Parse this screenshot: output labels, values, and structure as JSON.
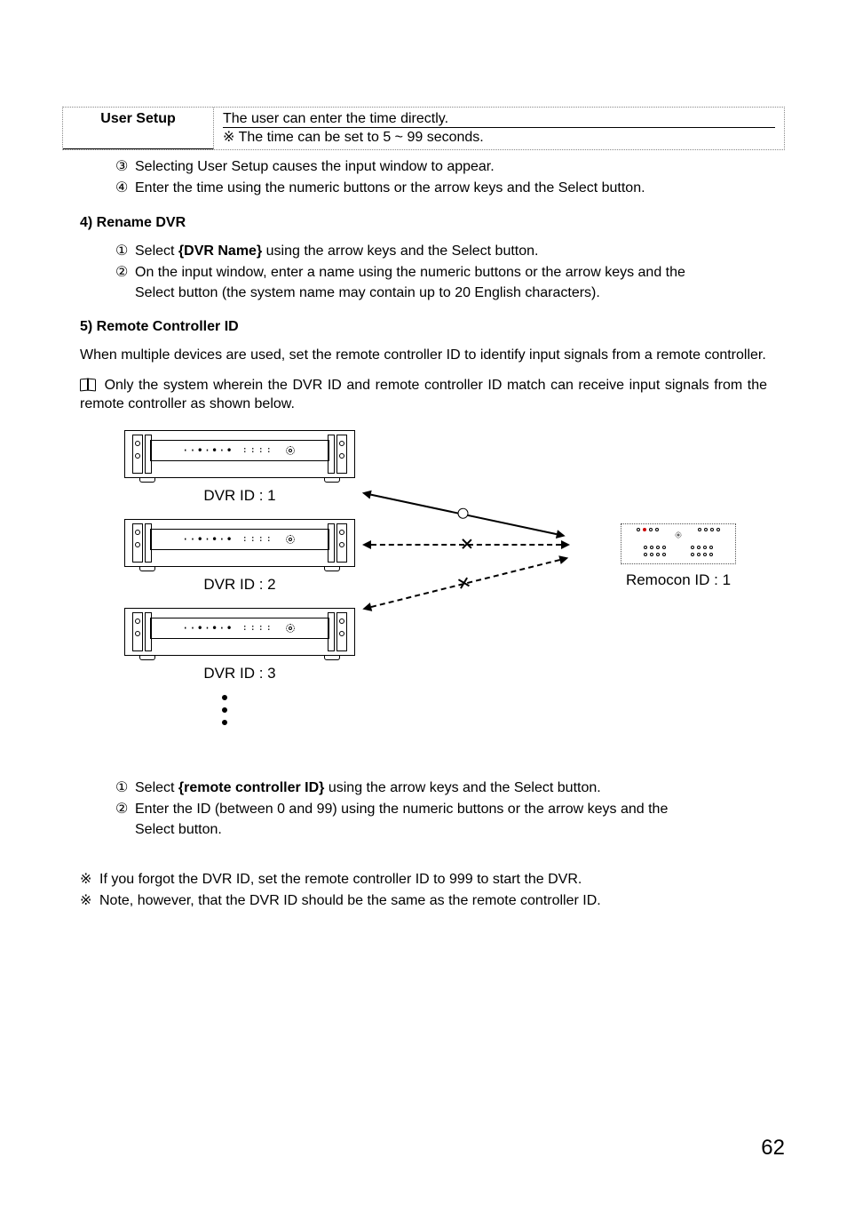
{
  "table": {
    "header": "User Setup",
    "line1": "The user can enter the time directly.",
    "line2_sym": "※",
    "line2": "The time can be set to 5 ~ 99 seconds."
  },
  "post_table": {
    "item3_num": "③",
    "item3": "Selecting User Setup causes the input window to appear.",
    "item4_num": "④",
    "item4": "Enter the time using the numeric buttons or the arrow keys and the Select button."
  },
  "section4": {
    "heading": "4)  Rename DVR",
    "item1_num": "①",
    "item1_pre": "Select ",
    "item1_bold": "{DVR Name}",
    "item1_post": " using the arrow keys and the Select button.",
    "item2_num": "②",
    "item2_line1": "On the input window, enter a name using the numeric buttons or the arrow keys and the",
    "item2_line2": "Select button (the system name may contain up to 20 English characters)."
  },
  "section5": {
    "heading": "5)  Remote Controller ID",
    "para1": "When multiple devices are used, set the remote controller ID to identify input signals from a remote controller.",
    "para2": "Only the system wherein the DVR ID and remote controller ID match can receive input signals from the remote controller as shown below.",
    "dvr1": "DVR ID : 1",
    "dvr2": "DVR ID : 2",
    "dvr3": "DVR ID : 3",
    "remote": "Remocon ID : 1",
    "item1_num": "①",
    "item1_pre": "Select ",
    "item1_bold": "{remote controller ID}",
    "item1_post": " using the arrow keys and the Select button.",
    "item2_num": "②",
    "item2_line1": "Enter the ID (between 0 and 99) using the numeric buttons or the arrow keys and the",
    "item2_line2": "Select button."
  },
  "footnotes": {
    "sym": "※",
    "n1": "If you forgot the DVR ID, set the remote controller ID to 999 to start the DVR.",
    "n2": "Note, however, that the DVR ID should be the same as the remote controller ID."
  },
  "page": "62"
}
